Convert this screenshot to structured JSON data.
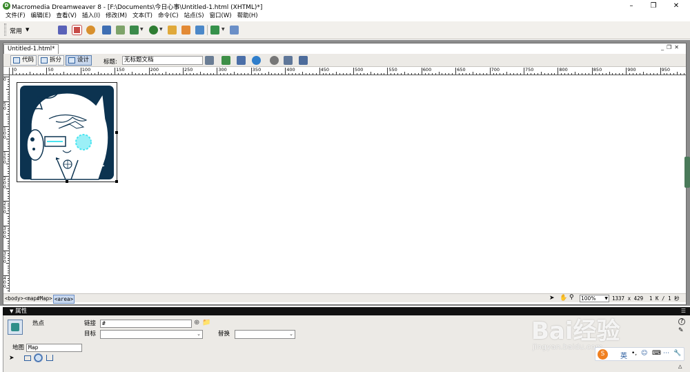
{
  "window": {
    "title": "Macromedia Dreamweaver 8 - [F:\\Documents\\今日心事\\Untitled-1.html (XHTML)*]",
    "app_icon_letter": "D"
  },
  "menubar": {
    "items": [
      "文件(F)",
      "编辑(E)",
      "查看(V)",
      "插入(I)",
      "修改(M)",
      "文本(T)",
      "命令(C)",
      "站点(S)",
      "窗口(W)",
      "帮助(H)"
    ]
  },
  "insertbar": {
    "category": "常用"
  },
  "document": {
    "tab_label": "Untitled-1.html*",
    "views": {
      "code": "代码",
      "split": "拆分",
      "design": "设计"
    },
    "title_label": "标题:",
    "title_value": "无标题文档",
    "hruler_ticks": [
      "0",
      "50",
      "100",
      "150",
      "200",
      "250",
      "300",
      "350",
      "400",
      "450",
      "500",
      "550",
      "600",
      "650",
      "700",
      "750",
      "800",
      "850",
      "900",
      "950",
      "1000",
      "1050",
      "1100",
      "1150",
      "1200",
      "1250",
      "1300"
    ],
    "vruler_ticks": [
      "0",
      "50",
      "100",
      "150",
      "200",
      "250",
      "300",
      "350",
      "400"
    ]
  },
  "statusbar": {
    "tags": [
      "<body>",
      "<map#Map>",
      "<area>"
    ],
    "zoom": "100%",
    "window_size": "1337 x 429",
    "download": "1 K / 1 秒"
  },
  "properties": {
    "header": "属性",
    "hotspot_label": "热点",
    "link_label": "链接",
    "link_value": "#",
    "target_label": "目标",
    "target_value": "",
    "alt_label": "替换",
    "alt_value": "",
    "map_label": "地图",
    "map_value": "Map"
  },
  "watermark": {
    "brand": "Bai经验",
    "url": "jingyan.baidu.com"
  },
  "ime": {
    "lang": "英"
  },
  "colors": {
    "title_bar": "#ffffff",
    "insert_bar": "#f2f0ec",
    "doc_frame": "#8c8c8c",
    "prop_header": "#111111",
    "prop_panel": "#eceae6",
    "image_bg": "#0c3350",
    "hotspot_cyan": "#49e4f0"
  }
}
